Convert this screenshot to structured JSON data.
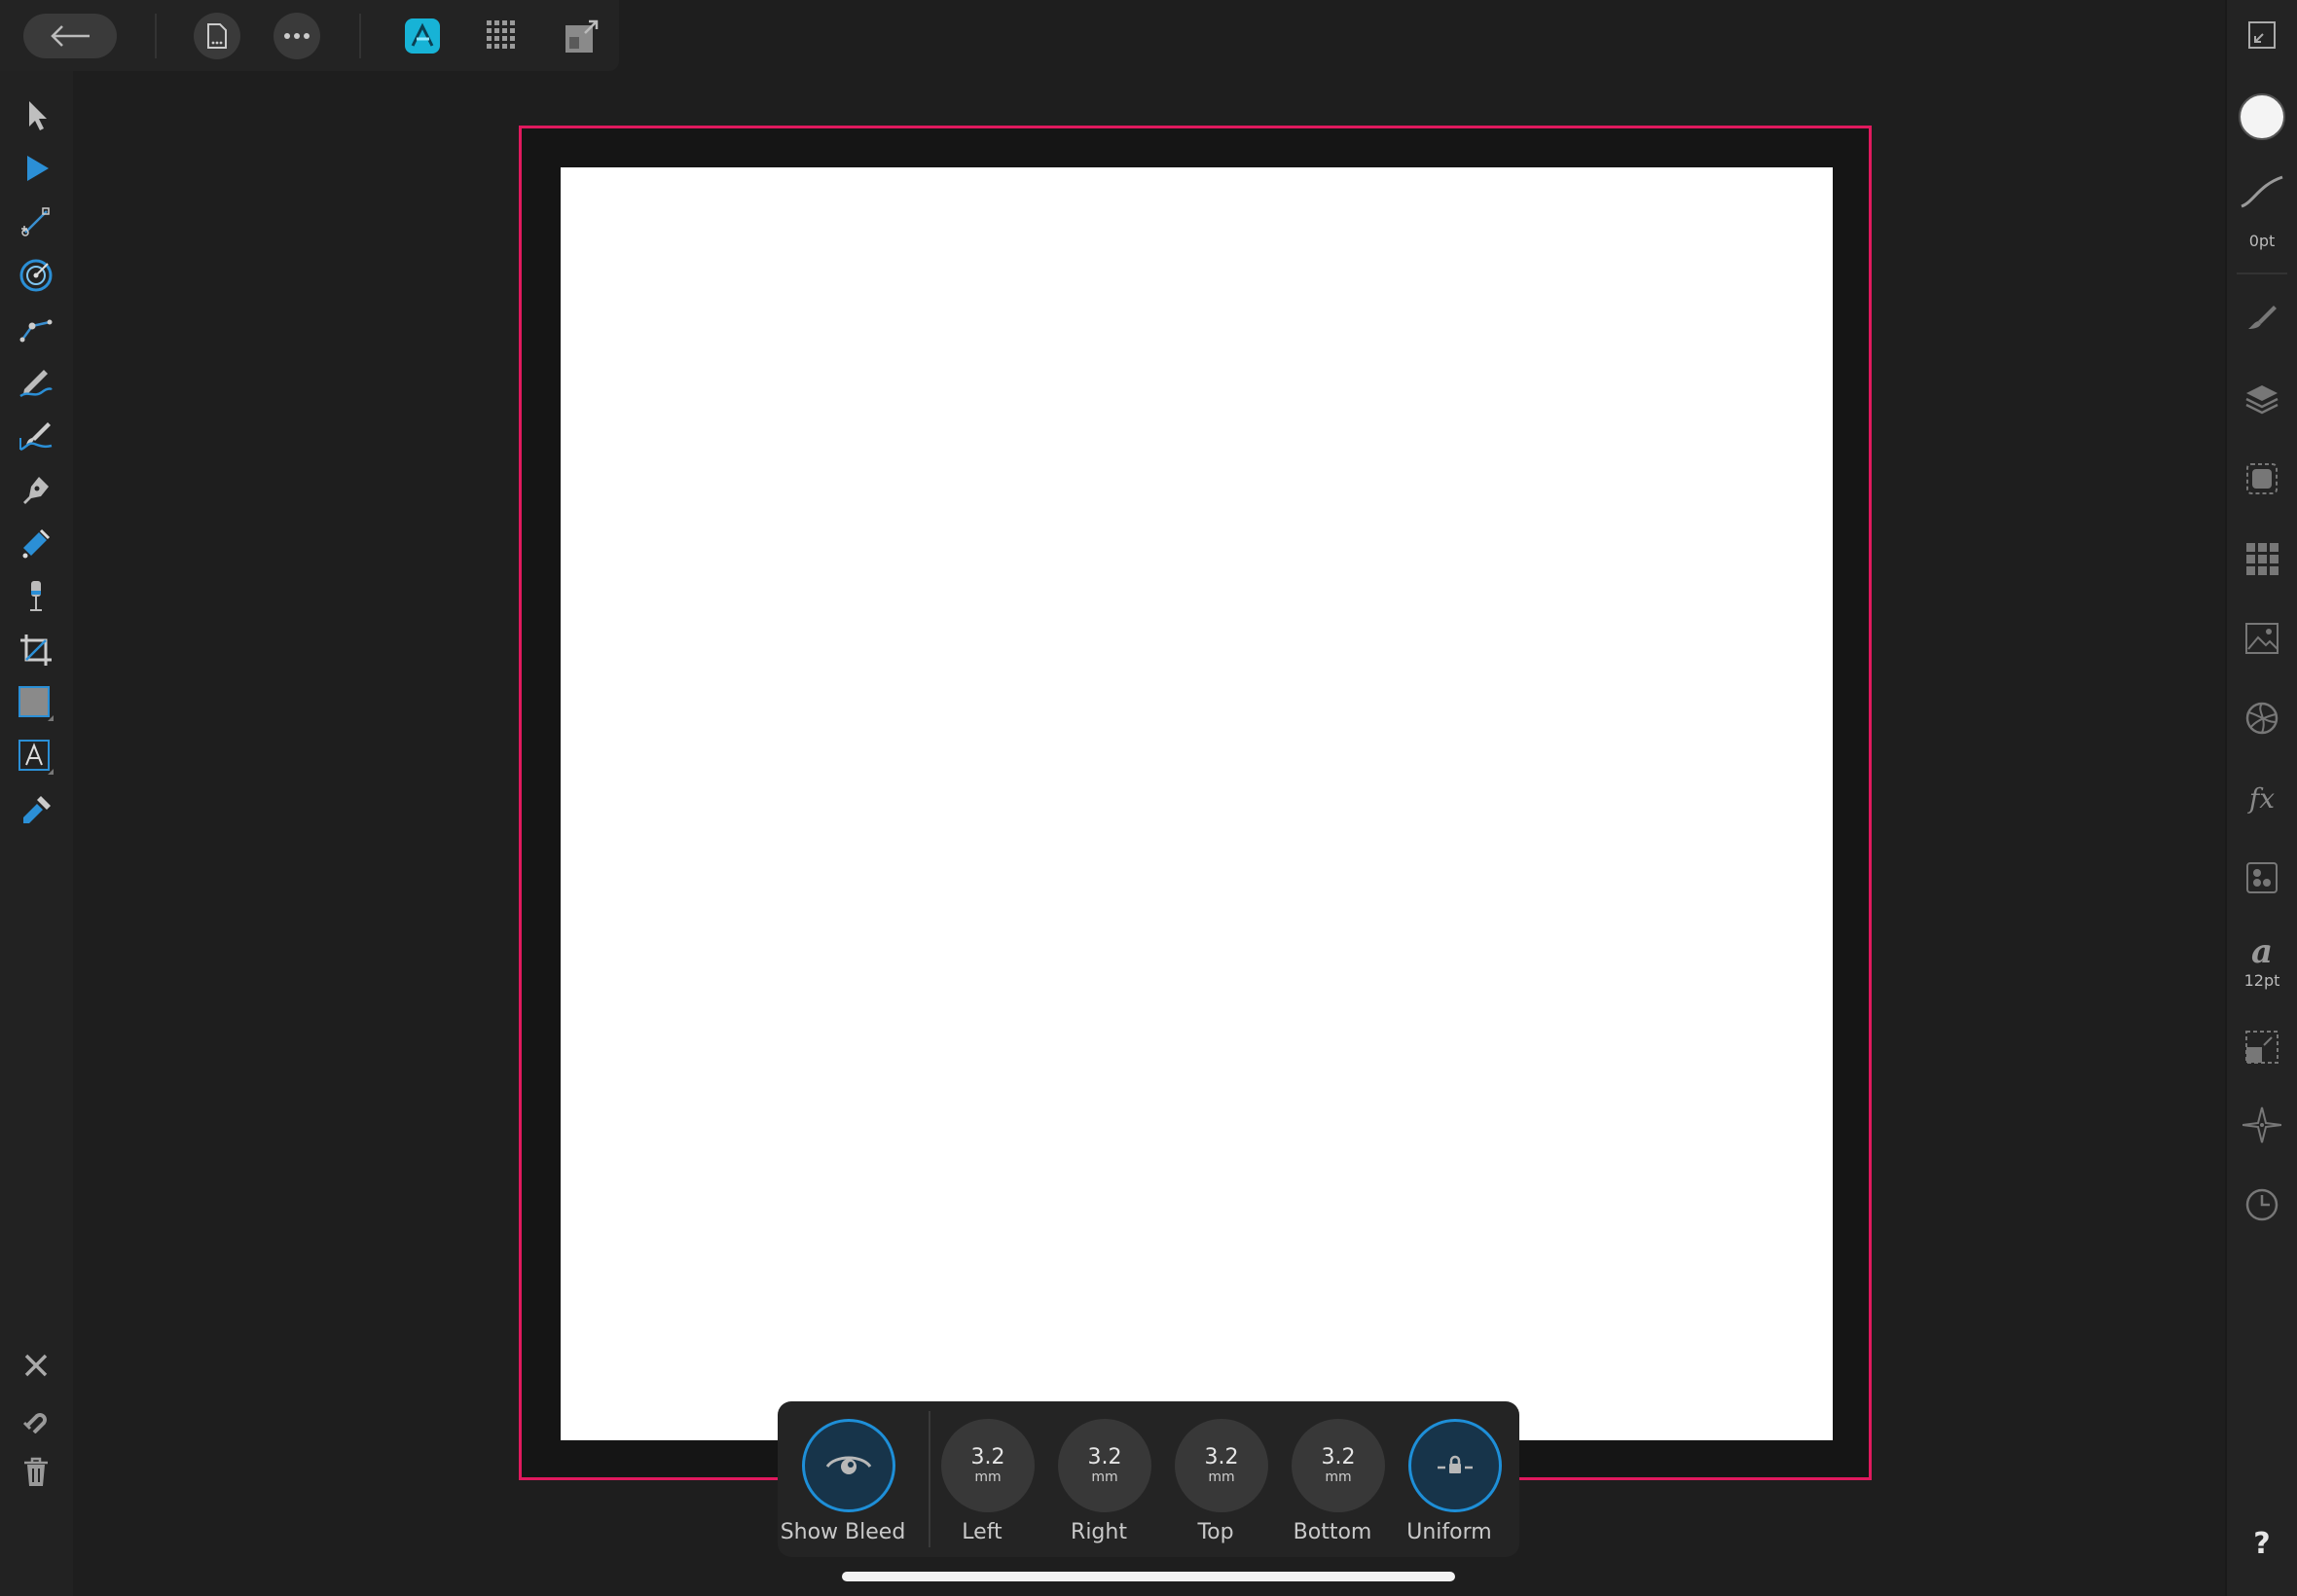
{
  "context_bar": {
    "show_bleed_label": "Show Bleed",
    "left": {
      "value": "3.2",
      "unit": "mm",
      "label": "Left"
    },
    "right": {
      "value": "3.2",
      "unit": "mm",
      "label": "Right"
    },
    "top": {
      "value": "3.2",
      "unit": "mm",
      "label": "Top"
    },
    "bottom": {
      "value": "3.2",
      "unit": "mm",
      "label": "Bottom"
    },
    "uniform_label": "Uniform"
  },
  "right_panel": {
    "stroke_width": "0pt",
    "font_size": "12pt",
    "help": "?"
  },
  "colors": {
    "bleed_line": "#e0195e",
    "accent": "#1e8fd8",
    "page": "#ffffff",
    "background": "#1e1e1e"
  },
  "left_tools": [
    "move-tool-icon",
    "node-tool-icon",
    "corner-tool-icon",
    "transparency-tool-icon",
    "point-transform-tool-icon",
    "pencil-tool-icon",
    "vector-brush-tool-icon",
    "pen-tool-icon",
    "fill-tool-icon",
    "place-image-tool-icon",
    "crop-tool-icon",
    "rectangle-tool-icon",
    "artistic-text-tool-icon",
    "color-picker-tool-icon"
  ]
}
